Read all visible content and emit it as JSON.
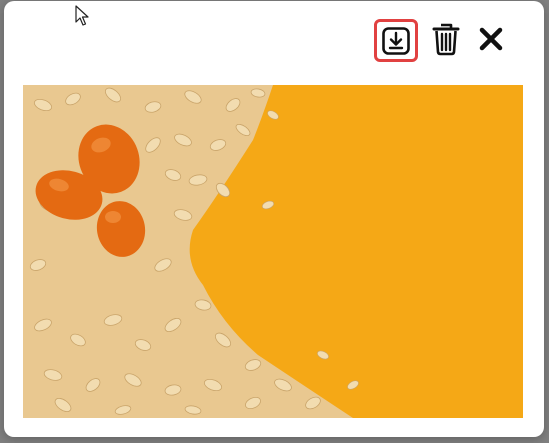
{
  "dialog": {
    "type": "image-preview",
    "actions": [
      {
        "name": "download",
        "icon": "download-icon",
        "highlighted": true
      },
      {
        "name": "delete",
        "icon": "trash-icon"
      },
      {
        "name": "close",
        "icon": "close-icon"
      }
    ]
  },
  "colors": {
    "highlight_border": "#e14141",
    "photo_background": "#f5a816",
    "icon": "#111111"
  },
  "image": {
    "subject": "kumquats-on-rolled-oats-orange-background"
  }
}
